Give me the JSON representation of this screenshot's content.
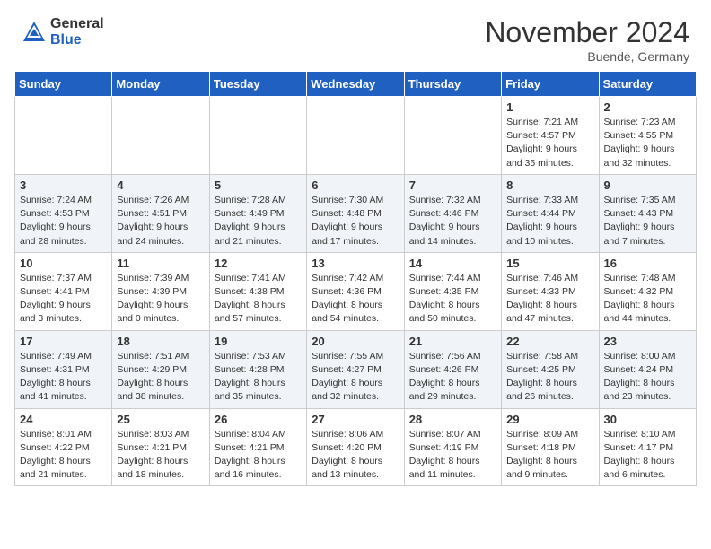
{
  "header": {
    "logo_general": "General",
    "logo_blue": "Blue",
    "title": "November 2024",
    "location": "Buende, Germany"
  },
  "days_of_week": [
    "Sunday",
    "Monday",
    "Tuesday",
    "Wednesday",
    "Thursday",
    "Friday",
    "Saturday"
  ],
  "weeks": [
    [
      {
        "day": "",
        "info": ""
      },
      {
        "day": "",
        "info": ""
      },
      {
        "day": "",
        "info": ""
      },
      {
        "day": "",
        "info": ""
      },
      {
        "day": "",
        "info": ""
      },
      {
        "day": "1",
        "info": "Sunrise: 7:21 AM\nSunset: 4:57 PM\nDaylight: 9 hours\nand 35 minutes."
      },
      {
        "day": "2",
        "info": "Sunrise: 7:23 AM\nSunset: 4:55 PM\nDaylight: 9 hours\nand 32 minutes."
      }
    ],
    [
      {
        "day": "3",
        "info": "Sunrise: 7:24 AM\nSunset: 4:53 PM\nDaylight: 9 hours\nand 28 minutes."
      },
      {
        "day": "4",
        "info": "Sunrise: 7:26 AM\nSunset: 4:51 PM\nDaylight: 9 hours\nand 24 minutes."
      },
      {
        "day": "5",
        "info": "Sunrise: 7:28 AM\nSunset: 4:49 PM\nDaylight: 9 hours\nand 21 minutes."
      },
      {
        "day": "6",
        "info": "Sunrise: 7:30 AM\nSunset: 4:48 PM\nDaylight: 9 hours\nand 17 minutes."
      },
      {
        "day": "7",
        "info": "Sunrise: 7:32 AM\nSunset: 4:46 PM\nDaylight: 9 hours\nand 14 minutes."
      },
      {
        "day": "8",
        "info": "Sunrise: 7:33 AM\nSunset: 4:44 PM\nDaylight: 9 hours\nand 10 minutes."
      },
      {
        "day": "9",
        "info": "Sunrise: 7:35 AM\nSunset: 4:43 PM\nDaylight: 9 hours\nand 7 minutes."
      }
    ],
    [
      {
        "day": "10",
        "info": "Sunrise: 7:37 AM\nSunset: 4:41 PM\nDaylight: 9 hours\nand 3 minutes."
      },
      {
        "day": "11",
        "info": "Sunrise: 7:39 AM\nSunset: 4:39 PM\nDaylight: 9 hours\nand 0 minutes."
      },
      {
        "day": "12",
        "info": "Sunrise: 7:41 AM\nSunset: 4:38 PM\nDaylight: 8 hours\nand 57 minutes."
      },
      {
        "day": "13",
        "info": "Sunrise: 7:42 AM\nSunset: 4:36 PM\nDaylight: 8 hours\nand 54 minutes."
      },
      {
        "day": "14",
        "info": "Sunrise: 7:44 AM\nSunset: 4:35 PM\nDaylight: 8 hours\nand 50 minutes."
      },
      {
        "day": "15",
        "info": "Sunrise: 7:46 AM\nSunset: 4:33 PM\nDaylight: 8 hours\nand 47 minutes."
      },
      {
        "day": "16",
        "info": "Sunrise: 7:48 AM\nSunset: 4:32 PM\nDaylight: 8 hours\nand 44 minutes."
      }
    ],
    [
      {
        "day": "17",
        "info": "Sunrise: 7:49 AM\nSunset: 4:31 PM\nDaylight: 8 hours\nand 41 minutes."
      },
      {
        "day": "18",
        "info": "Sunrise: 7:51 AM\nSunset: 4:29 PM\nDaylight: 8 hours\nand 38 minutes."
      },
      {
        "day": "19",
        "info": "Sunrise: 7:53 AM\nSunset: 4:28 PM\nDaylight: 8 hours\nand 35 minutes."
      },
      {
        "day": "20",
        "info": "Sunrise: 7:55 AM\nSunset: 4:27 PM\nDaylight: 8 hours\nand 32 minutes."
      },
      {
        "day": "21",
        "info": "Sunrise: 7:56 AM\nSunset: 4:26 PM\nDaylight: 8 hours\nand 29 minutes."
      },
      {
        "day": "22",
        "info": "Sunrise: 7:58 AM\nSunset: 4:25 PM\nDaylight: 8 hours\nand 26 minutes."
      },
      {
        "day": "23",
        "info": "Sunrise: 8:00 AM\nSunset: 4:24 PM\nDaylight: 8 hours\nand 23 minutes."
      }
    ],
    [
      {
        "day": "24",
        "info": "Sunrise: 8:01 AM\nSunset: 4:22 PM\nDaylight: 8 hours\nand 21 minutes."
      },
      {
        "day": "25",
        "info": "Sunrise: 8:03 AM\nSunset: 4:21 PM\nDaylight: 8 hours\nand 18 minutes."
      },
      {
        "day": "26",
        "info": "Sunrise: 8:04 AM\nSunset: 4:21 PM\nDaylight: 8 hours\nand 16 minutes."
      },
      {
        "day": "27",
        "info": "Sunrise: 8:06 AM\nSunset: 4:20 PM\nDaylight: 8 hours\nand 13 minutes."
      },
      {
        "day": "28",
        "info": "Sunrise: 8:07 AM\nSunset: 4:19 PM\nDaylight: 8 hours\nand 11 minutes."
      },
      {
        "day": "29",
        "info": "Sunrise: 8:09 AM\nSunset: 4:18 PM\nDaylight: 8 hours\nand 9 minutes."
      },
      {
        "day": "30",
        "info": "Sunrise: 8:10 AM\nSunset: 4:17 PM\nDaylight: 8 hours\nand 6 minutes."
      }
    ]
  ]
}
